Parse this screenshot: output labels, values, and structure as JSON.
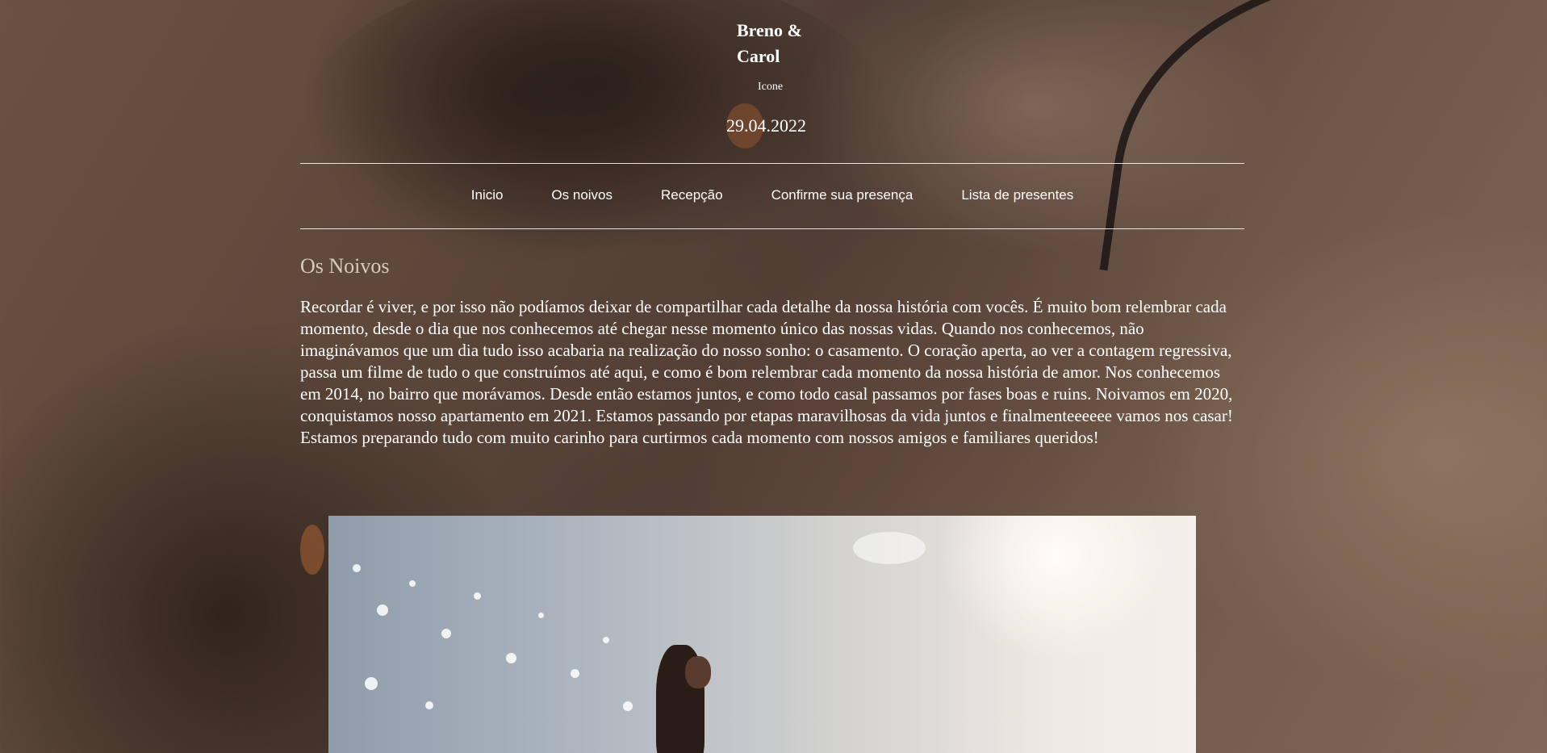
{
  "header": {
    "brand": "Breno & Carol",
    "icon_label": "Icone",
    "date": "29.04.2022"
  },
  "nav": {
    "items": [
      {
        "label": "Inicio"
      },
      {
        "label": "Os noivos"
      },
      {
        "label": "Recepção"
      },
      {
        "label": "Confirme sua presença"
      },
      {
        "label": "Lista de presentes"
      }
    ]
  },
  "main": {
    "section_title": "Os Noivos",
    "story": "Recordar é viver, e por isso não podíamos deixar de compartilhar cada detalhe da nossa história com vocês. É muito bom relembrar cada momento, desde o dia que nos conhecemos até chegar nesse momento único das nossas vidas. Quando nos conhecemos, não imaginávamos que um dia tudo isso acabaria na realização do nosso sonho: o casamento. O coração aperta, ao ver a contagem regressiva, passa um filme de tudo o que construímos até aqui, e como é bom relembrar cada momento da nossa história de amor. Nos conhecemos em 2014, no bairro que morávamos. Desde então estamos juntos, e como todo casal passamos por fases boas e ruins. Noivamos em 2020, conquistamos nosso apartamento em 2021. Estamos passando por etapas maravilhosas da vida juntos e finalmenteeeeee vamos nos casar! Estamos preparando tudo com muito carinho para curtirmos cada momento com nossos amigos e familiares queridos!"
  }
}
